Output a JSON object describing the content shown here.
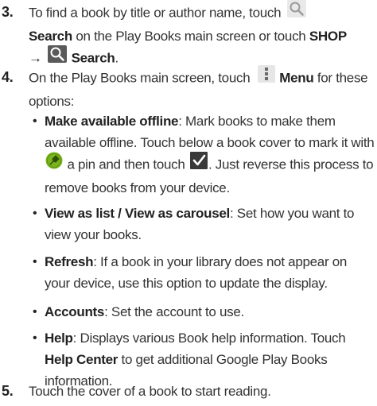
{
  "steps": [
    {
      "number": "3.",
      "parts": [
        "To find a book by title or author name, touch",
        "Search",
        "on the Play Books main screen or touch",
        "SHOP",
        "→",
        "Search",
        "."
      ]
    },
    {
      "number": "4.",
      "parts": [
        "On the Play Books main screen, touch",
        "Menu",
        "for these options:"
      ]
    },
    {
      "number": "5.",
      "text": "Touch the cover of a book to start reading."
    }
  ],
  "bullets": [
    {
      "term": "Make available offline",
      "parts": [
        ": Mark books to make them available offline. Touch below a book cover to mark it with",
        "a pin and then touch",
        ". Just reverse this process to remove books from your device."
      ]
    },
    {
      "term": "View as list / View as carousel",
      "desc": ": Set how you want to view your books."
    },
    {
      "term": "Refresh",
      "desc": ": If a book in your library does not appear on your device, use this option to update the display."
    },
    {
      "term": "Accounts",
      "desc": ": Set the account to use."
    },
    {
      "term": "Help",
      "parts": [
        ": Displays various Book help information. Touch",
        "Help Center",
        "to get additional Google Play Books information."
      ]
    }
  ],
  "bullet_symbol": "•",
  "icons": {
    "search": "search-icon",
    "menu": "overflow-menu-icon",
    "pin": "pin-icon",
    "check": "checkmark-icon"
  },
  "colors": {
    "text": "#333333",
    "pin_green": "#7ab51d",
    "check_fill": "#3a3a3a"
  }
}
